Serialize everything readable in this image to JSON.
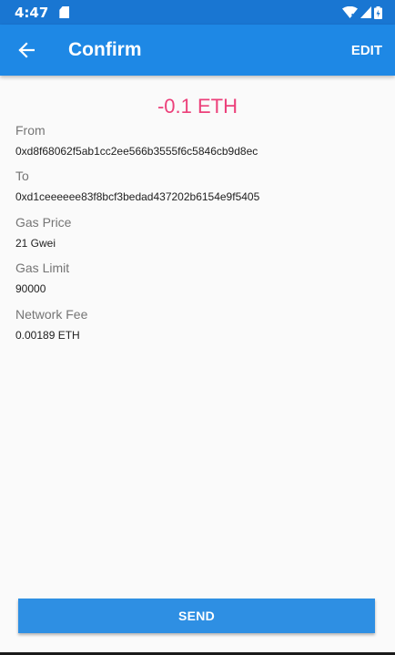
{
  "status_bar": {
    "time": "4:47",
    "icons": [
      "sd-card-icon",
      "wifi-icon",
      "signal-icon",
      "battery-icon"
    ]
  },
  "toolbar": {
    "title": "Confirm",
    "back_icon": "arrow-back-icon",
    "edit_label": "EDIT"
  },
  "transaction": {
    "amount": "-0.1 ETH",
    "amount_color": "#ec407a",
    "fields": [
      {
        "label": "From",
        "value": "0xd8f68062f5ab1cc2ee566b3555f6c5846cb9d8ec"
      },
      {
        "label": "To",
        "value": "0xd1ceeeeee83f8bcf3bedad437202b6154e9f5405"
      },
      {
        "label": "Gas Price",
        "value": "21 Gwei"
      },
      {
        "label": "Gas Limit",
        "value": "90000"
      },
      {
        "label": "Network Fee",
        "value": "0.00189 ETH"
      }
    ]
  },
  "actions": {
    "send_label": "SEND"
  },
  "colors": {
    "primary": "#1e88e5",
    "primary_dark": "#1976d2",
    "button": "#2e8fe3"
  }
}
